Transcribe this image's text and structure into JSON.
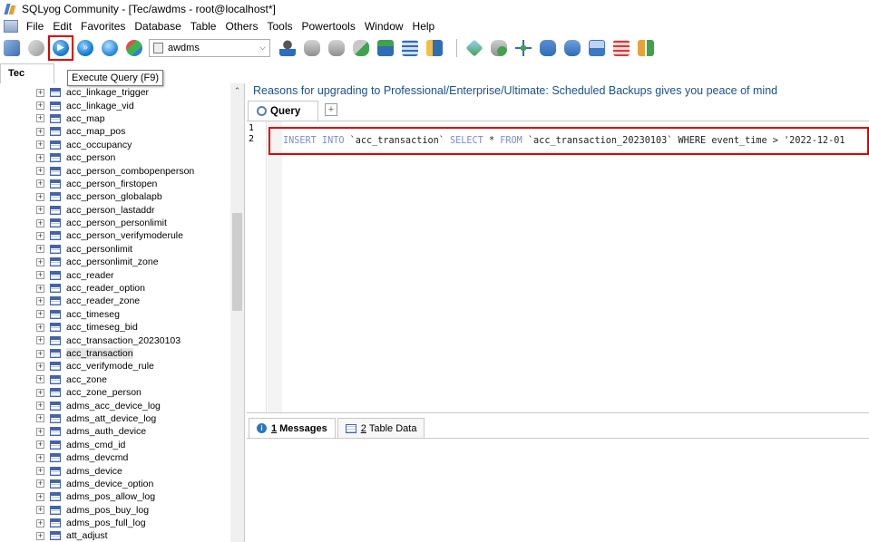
{
  "window": {
    "title": "SQLyog Community - [Tec/awdms - root@localhost*]"
  },
  "menu": [
    "File",
    "Edit",
    "Favorites",
    "Database",
    "Table",
    "Others",
    "Tools",
    "Powertools",
    "Window",
    "Help"
  ],
  "toolbar": {
    "database_select": "awdms",
    "tooltip": "Execute Query (F9)"
  },
  "object_browser": {
    "connection_tab": "Tec",
    "tables": [
      "acc_linkage_trigger",
      "acc_linkage_vid",
      "acc_map",
      "acc_map_pos",
      "acc_occupancy",
      "acc_person",
      "acc_person_combopenperson",
      "acc_person_firstopen",
      "acc_person_globalapb",
      "acc_person_lastaddr",
      "acc_person_personlimit",
      "acc_person_verifymoderule",
      "acc_personlimit",
      "acc_personlimit_zone",
      "acc_reader",
      "acc_reader_option",
      "acc_reader_zone",
      "acc_timeseg",
      "acc_timeseg_bid",
      "acc_transaction_20230103",
      "acc_transaction",
      "acc_verifymode_rule",
      "acc_zone",
      "acc_zone_person",
      "adms_acc_device_log",
      "adms_att_device_log",
      "adms_auth_device",
      "adms_cmd_id",
      "adms_devcmd",
      "adms_device",
      "adms_device_option",
      "adms_pos_allow_log",
      "adms_pos_buy_log",
      "adms_pos_full_log",
      "att_adjust"
    ],
    "selected_table": "acc_transaction"
  },
  "banner": "Reasons for upgrading to Professional/Enterprise/Ultimate: Scheduled Backups gives you peace of mind",
  "editor": {
    "tab_label": "Query",
    "line_numbers": [
      "1",
      "2"
    ],
    "code": {
      "k1": "INSERT INTO",
      "t1": " `acc_transaction` ",
      "k2": "SELECT",
      "t2": " * ",
      "k3": "FROM",
      "t3": " `acc_transaction_20230103` WHERE event_time > '2022-12-01"
    }
  },
  "results_tabs": {
    "messages": {
      "number": "1",
      "label": "Messages"
    },
    "table_data": {
      "number": "2",
      "label": "Table Data"
    }
  }
}
